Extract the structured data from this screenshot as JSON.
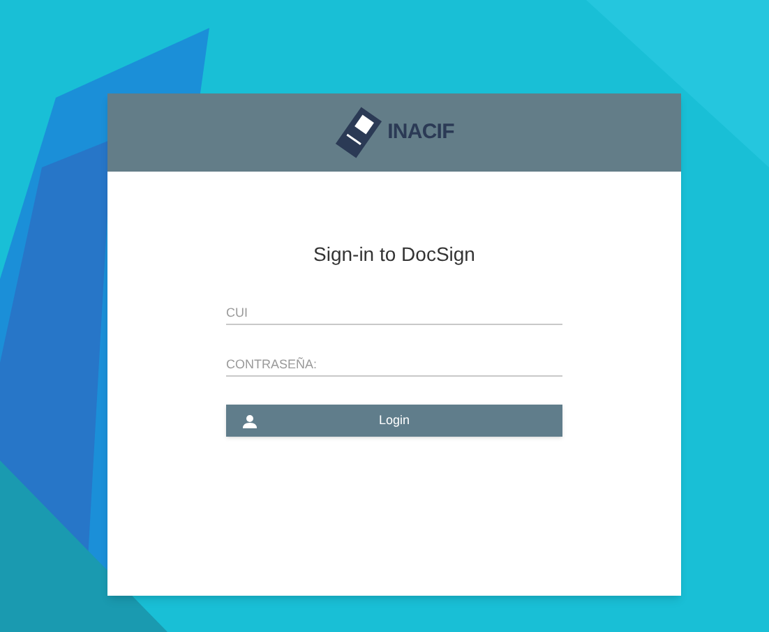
{
  "header": {
    "logo_text": "INACIF"
  },
  "title": "Sign-in to DocSign",
  "fields": [
    {
      "placeholder": "CUI"
    },
    {
      "placeholder": "CONTRASEÑA:"
    }
  ],
  "login_button": {
    "label": "Login"
  }
}
